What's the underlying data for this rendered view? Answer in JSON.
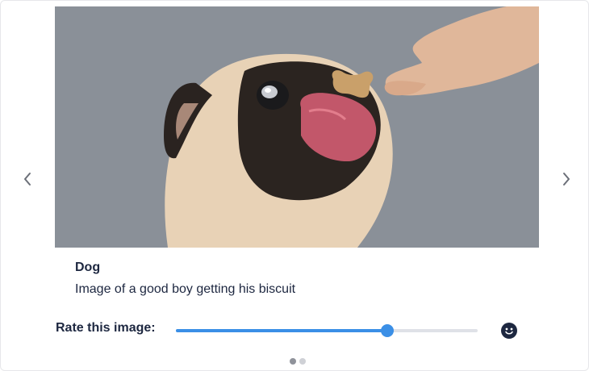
{
  "carousel": {
    "prev_icon": "chevron-left-icon",
    "next_icon": "chevron-right-icon",
    "slide": {
      "title": "Dog",
      "description": "Image of a good boy getting his biscuit",
      "image_subject": "pug-eating-biscuit-photo"
    },
    "pagination": {
      "total": 2,
      "active_index": 0
    }
  },
  "rating": {
    "label": "Rate this image:",
    "value_fraction": 0.7,
    "indicator_icon": "smiley-face-icon"
  },
  "colors": {
    "accent": "#3b8fe6",
    "text": "#1d2740",
    "track": "#dfe1e7",
    "photo_background": "#8a9098"
  }
}
